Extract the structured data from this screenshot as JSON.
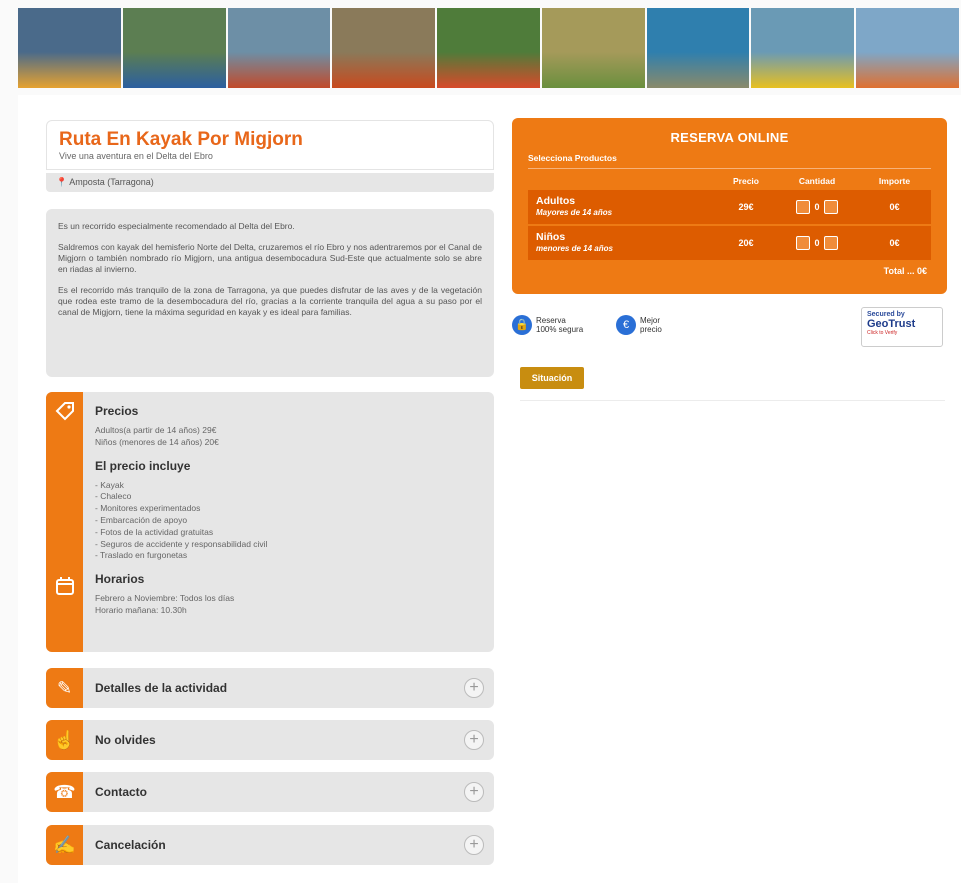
{
  "banner": {
    "photos": [
      {
        "name": "kayak-photo-1",
        "colors": [
          "#4a6a8a",
          "#e6a230"
        ]
      },
      {
        "name": "kayak-photo-2",
        "colors": [
          "#5c7e52",
          "#2c5fa0"
        ]
      },
      {
        "name": "kayak-photo-3",
        "colors": [
          "#6d8fa6",
          "#c24a2a"
        ]
      },
      {
        "name": "kayak-photo-4",
        "colors": [
          "#8a7a5a",
          "#c84a1e"
        ]
      },
      {
        "name": "kayak-photo-5",
        "colors": [
          "#4f7c3a",
          "#d84a2a"
        ]
      },
      {
        "name": "kayak-photo-6",
        "colors": [
          "#a59a5a",
          "#6a8f3e"
        ]
      },
      {
        "name": "kayak-photo-7",
        "colors": [
          "#2f7fae",
          "#8a8a6a"
        ]
      },
      {
        "name": "kayak-photo-8",
        "colors": [
          "#6a9ab5",
          "#e8c020"
        ]
      },
      {
        "name": "kayak-photo-9",
        "colors": [
          "#7ea7c8",
          "#e07030"
        ]
      }
    ]
  },
  "activity": {
    "title": "Ruta En Kayak Por Migjorn",
    "subtitle": "Vive una aventura en el Delta del Ebro",
    "location": "Amposta (Tarragona)"
  },
  "description": {
    "paragraphs": [
      "Es un recorrido especialmente recomendado al Delta del Ebro.",
      "Saldremos con kayak del hemisferio Norte del Delta, cruzaremos el río Ebro y nos adentraremos por el Canal de Migjorn o también nombrado río Migjorn, una antigua desembocadura Sud-Este que actualmente solo se abre en riadas al invierno.",
      "Es el recorrido más tranquilo de la zona de Tarragona, ya que puedes disfrutar de las aves y de la vegetación que rodea este tramo de la desembocadura del río, gracias a la corriente tranquila del agua a su paso por el canal de Migjorn, tiene la máxima seguridad en kayak y es ideal para familias."
    ]
  },
  "info": {
    "precios_title": "Precios",
    "precios": [
      "Adultos(a partir de 14 años) 29€",
      "Niños (menores de 14 años) 20€"
    ],
    "incluye_title": "El precio incluye",
    "incluye": [
      "- Kayak",
      "- Chaleco",
      "- Monitores experimentados",
      "- Embarcación de apoyo",
      "- Fotos de la actividad gratuitas",
      "- Seguros de accidente y responsabilidad civil",
      "- Traslado en furgonetas"
    ],
    "horarios_title": "Horarios",
    "horarios": [
      "Febrero a Noviembre: Todos los días",
      "Horario mañana: 10.30h"
    ],
    "tag_icon": "price-tag-icon",
    "calendar_icon": "calendar-icon"
  },
  "accordions": [
    {
      "label": "Detalles de la actividad",
      "icon": "notebook-icon",
      "glyph": "✎"
    },
    {
      "label": "No olvides",
      "icon": "hand-pointer-icon",
      "glyph": "☝"
    },
    {
      "label": "Contacto",
      "icon": "phone-icon",
      "glyph": "☎"
    },
    {
      "label": "Cancelación",
      "icon": "cancel-form-icon",
      "glyph": "✍"
    }
  ],
  "booking": {
    "title": "RESERVA ONLINE",
    "subtitle": "Selecciona Productos",
    "headers": {
      "price": "Precio",
      "qty": "Cantidad",
      "amount": "Importe"
    },
    "rows": [
      {
        "name": "Adultos",
        "note": "Mayores de 14 años",
        "price": "29€",
        "qty": "0",
        "amount": "0€"
      },
      {
        "name": "Niños",
        "note": "menores de 14 años",
        "price": "20€",
        "qty": "0",
        "amount": "0€"
      }
    ],
    "total": "Total ... 0€"
  },
  "trust": {
    "secure_line1": "Reserva",
    "secure_line2": "100% segura",
    "best_line1": "Mejor",
    "best_line2": "precio",
    "geotrust_top": "Secured by",
    "geotrust_brand": "GeoTrust",
    "geotrust_bottom": "Click to Verify"
  },
  "situacion": "Situación",
  "colors": {
    "accent": "#ee7a14",
    "accent_dark": "#dd5c00",
    "title": "#e8671a",
    "panel": "#e6e6e6",
    "situacion": "#c88d10"
  }
}
